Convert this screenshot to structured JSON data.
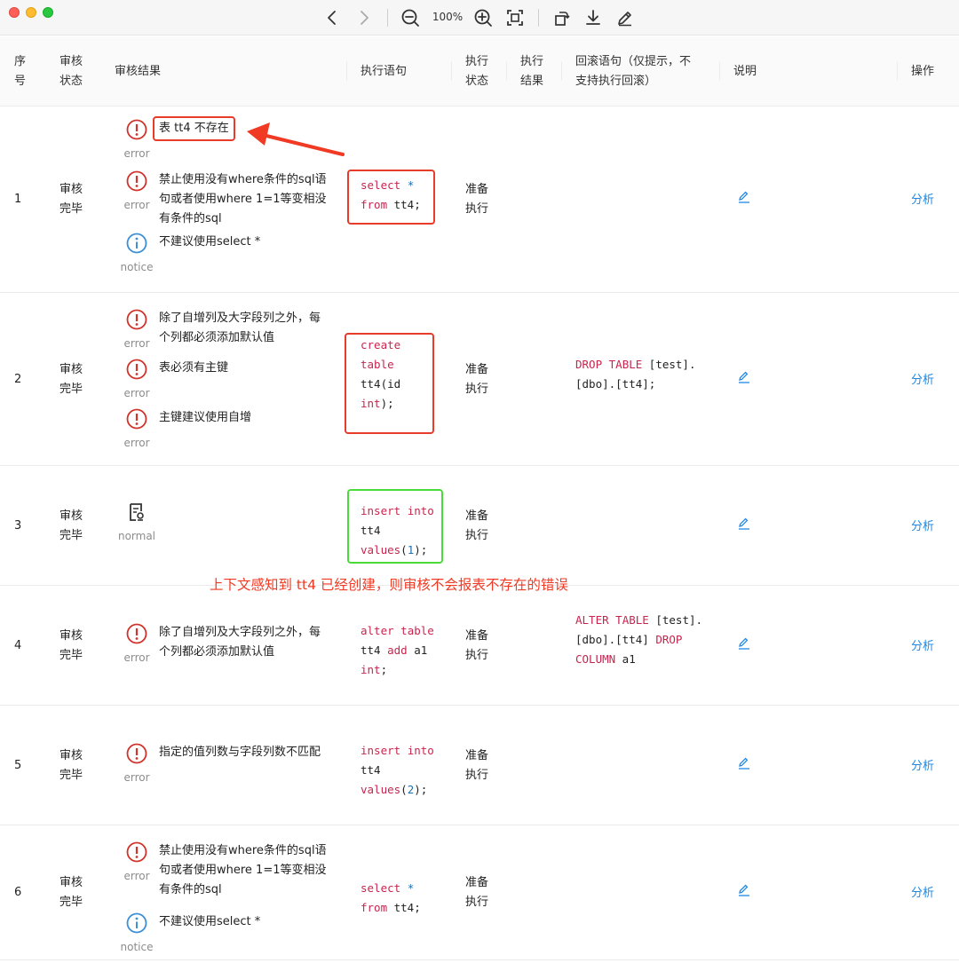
{
  "toolbar": {
    "zoom_level": "100%",
    "icons": [
      "chevron-left-icon",
      "chevron-right-icon",
      "zoom-out-icon",
      "zoom-in-icon",
      "fit-screen-icon",
      "rotate-icon",
      "download-icon",
      "pen-icon"
    ]
  },
  "table": {
    "headers": {
      "seq": [
        "序",
        "号"
      ],
      "audit_status": [
        "审核",
        "状态"
      ],
      "audit_result": "审核结果",
      "exec_sql": "执行语句",
      "exec_status": [
        "执行",
        "状态"
      ],
      "exec_result": [
        "执行",
        "结果"
      ],
      "rollback": [
        "回滚语句（仅提示，不",
        "支持执行回滚）"
      ],
      "desc": "说明",
      "action": "操作"
    },
    "rows": [
      {
        "seq": "1",
        "audit_status": [
          "审核",
          "完毕"
        ],
        "results": [
          {
            "level": "error",
            "lines": [
              "表 tt4 不存在"
            ]
          },
          {
            "level": "error",
            "lines": [
              "禁止使用没有where条件的sql语",
              "句或者使用where 1=1等变相没",
              "有条件的sql"
            ]
          },
          {
            "level": "notice",
            "lines": [
              "不建议使用select *"
            ]
          }
        ],
        "sql_lines": [
          [
            "select *"
          ],
          [
            "from tt4;"
          ]
        ],
        "exec_status": [
          "准备",
          "执行"
        ],
        "rollback": [],
        "action": "分析"
      },
      {
        "seq": "2",
        "audit_status": [
          "审核",
          "完毕"
        ],
        "results": [
          {
            "level": "error",
            "lines": [
              "除了自增列及大字段列之外，每",
              "个列都必须添加默认值"
            ]
          },
          {
            "level": "error",
            "lines": [
              "表必须有主键"
            ]
          },
          {
            "level": "error",
            "lines": [
              "主键建议使用自增"
            ]
          }
        ],
        "sql_lines": [
          "create",
          "table",
          "tt4(id",
          "int);"
        ],
        "exec_status": [
          "准备",
          "执行"
        ],
        "rollback": [
          "DROP TABLE [test].",
          "[dbo].[tt4];"
        ],
        "action": "分析"
      },
      {
        "seq": "3",
        "audit_status": [
          "审核",
          "完毕"
        ],
        "results": [
          {
            "level": "normal",
            "lines": []
          }
        ],
        "sql_lines": [
          "insert into",
          "tt4",
          "values(1);"
        ],
        "exec_status": [
          "准备",
          "执行"
        ],
        "rollback": [],
        "action": "分析"
      },
      {
        "seq": "4",
        "audit_status": [
          "审核",
          "完毕"
        ],
        "results": [
          {
            "level": "error",
            "lines": [
              "除了自增列及大字段列之外，每",
              "个列都必须添加默认值"
            ]
          }
        ],
        "sql_lines": [
          "alter table",
          "tt4 add a1",
          "int;"
        ],
        "exec_status": [
          "准备",
          "执行"
        ],
        "rollback": [
          "ALTER TABLE [test].",
          "[dbo].[tt4] DROP",
          "COLUMN a1"
        ],
        "action": "分析"
      },
      {
        "seq": "5",
        "audit_status": [
          "审核",
          "完毕"
        ],
        "results": [
          {
            "level": "error",
            "lines": [
              "指定的值列数与字段列数不匹配"
            ]
          }
        ],
        "sql_lines": [
          "insert into",
          "tt4",
          "values(2);"
        ],
        "exec_status": [
          "准备",
          "执行"
        ],
        "rollback": [],
        "action": "分析"
      },
      {
        "seq": "6",
        "audit_status": [
          "审核",
          "完毕"
        ],
        "results": [
          {
            "level": "error",
            "lines": [
              "禁止使用没有where条件的sql语",
              "句或者使用where 1=1等变相没",
              "有条件的sql"
            ]
          },
          {
            "level": "notice",
            "lines": [
              "不建议使用select *"
            ]
          }
        ],
        "sql_lines": [
          "select *",
          "from tt4;"
        ],
        "exec_status": [
          "准备",
          "执行"
        ],
        "rollback": [],
        "action": "分析"
      }
    ]
  },
  "annotation": "上下文感知到 tt4 已经创建，则审核不会报表不存在的错误",
  "colors": {
    "error": "#d0342c",
    "notice": "#3d8fd6",
    "highlight": "#e83b2a",
    "highlight_ok": "#4cd93a",
    "link": "#1e88e5",
    "keyword": "#c7254e"
  }
}
